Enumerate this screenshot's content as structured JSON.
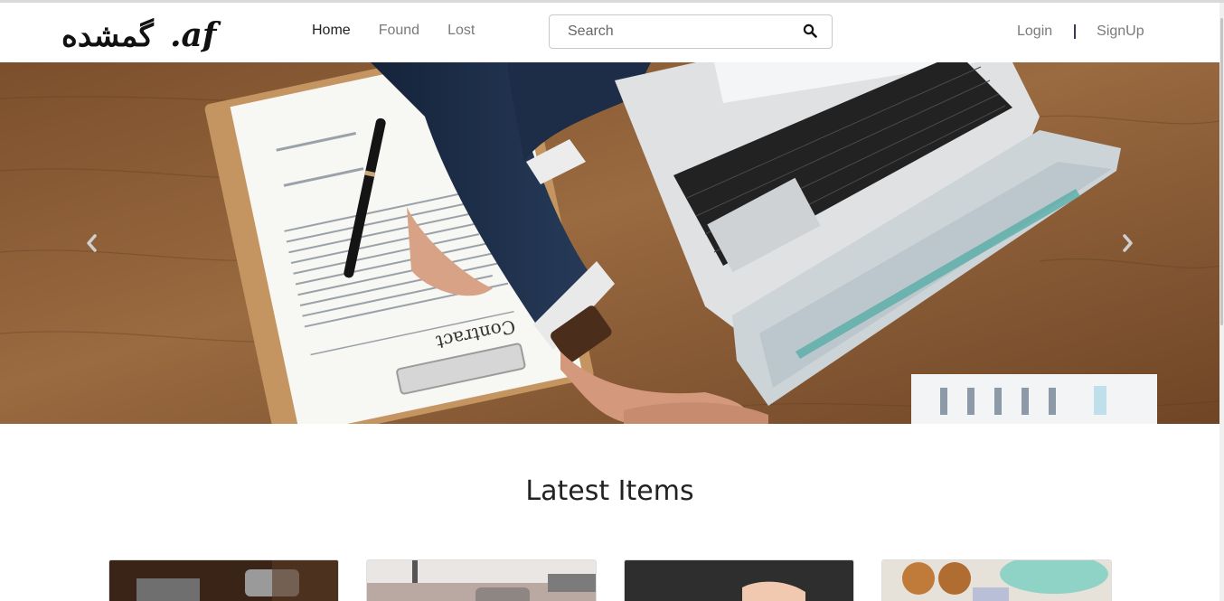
{
  "brand": {
    "logo_text": ".گمشده.af",
    "logo_latin": ".af",
    "logo_arabic": "گمشده"
  },
  "nav": {
    "links": [
      {
        "label": "Home",
        "active": true
      },
      {
        "label": "Found",
        "active": false
      },
      {
        "label": "Lost",
        "active": false
      }
    ]
  },
  "search": {
    "placeholder": "Search",
    "value": "",
    "icon": "search-icon"
  },
  "auth": {
    "login_label": "Login",
    "signup_label": "SignUp"
  },
  "hero": {
    "image": "handshake-over-desk-with-contract-and-laptop",
    "document_heading": "Contract",
    "prev_icon": "chevron-left-icon",
    "next_icon": "chevron-right-icon"
  },
  "latest": {
    "title": "Latest Items",
    "cards": [
      {
        "image": "dark-metal-object-photo"
      },
      {
        "image": "street-scene-photo"
      },
      {
        "image": "dark-hands-photo"
      },
      {
        "image": "sunglasses-and-hat-photo"
      }
    ]
  },
  "colors": {
    "nav_active": "#222222",
    "nav_inactive": "#7a7a7a",
    "separator": "#3a3a55",
    "wood": "#8a5a34"
  }
}
